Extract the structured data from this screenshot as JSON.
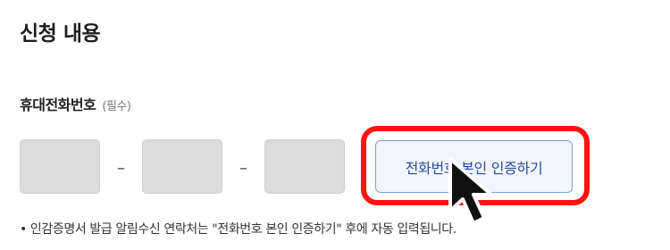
{
  "section": {
    "title": "신청 내용"
  },
  "phone_field": {
    "label": "휴대전화번호",
    "required_tag": "(필수)",
    "part1": "",
    "part2": "",
    "part3": "",
    "separator": "–"
  },
  "verify_button": {
    "label": "전화번호 본인 인증하기"
  },
  "note": "• 인감증명서 발급 알림수신 연락처는 \"전화번호 본인 인증하기\" 후에 자동 입력됩니다.",
  "colors": {
    "highlight": "#ff1212",
    "button_text": "#2b4e96",
    "button_border": "#7f9fd8",
    "button_bg": "#f0f5fe",
    "input_bg": "#dcdcdc"
  },
  "icons": {
    "pointer": "mouse-cursor-icon"
  }
}
